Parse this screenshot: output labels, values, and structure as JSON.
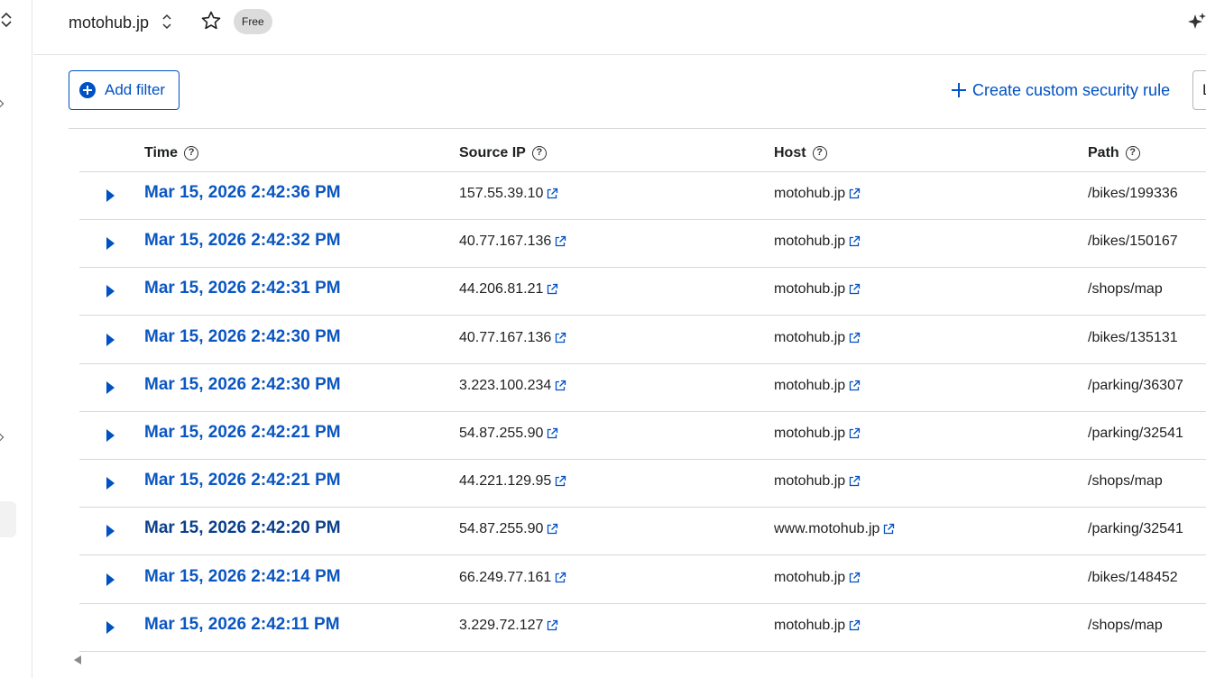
{
  "topbar": {
    "site": "motohub.jp",
    "plan_badge": "Free"
  },
  "toolbar": {
    "add_filter": "Add filter",
    "create_rule": "Create custom security rule",
    "cut_button_text": "L"
  },
  "table": {
    "columns": [
      "Time",
      "Source IP",
      "Host",
      "Path"
    ],
    "rows": [
      {
        "time": "Mar 15, 2026 2:42:36 PM",
        "ip": "157.55.39.10",
        "host": "motohub.jp",
        "path": "/bikes/199336"
      },
      {
        "time": "Mar 15, 2026 2:42:32 PM",
        "ip": "40.77.167.136",
        "host": "motohub.jp",
        "path": "/bikes/150167"
      },
      {
        "time": "Mar 15, 2026 2:42:31 PM",
        "ip": "44.206.81.21",
        "host": "motohub.jp",
        "path": "/shops/map"
      },
      {
        "time": "Mar 15, 2026 2:42:30 PM",
        "ip": "40.77.167.136",
        "host": "motohub.jp",
        "path": "/bikes/135131"
      },
      {
        "time": "Mar 15, 2026 2:42:30 PM",
        "ip": "3.223.100.234",
        "host": "motohub.jp",
        "path": "/parking/36307"
      },
      {
        "time": "Mar 15, 2026 2:42:21 PM",
        "ip": "54.87.255.90",
        "host": "motohub.jp",
        "path": "/parking/32541"
      },
      {
        "time": "Mar 15, 2026 2:42:21 PM",
        "ip": "44.221.129.95",
        "host": "motohub.jp",
        "path": "/shops/map"
      },
      {
        "time": "Mar 15, 2026 2:42:20 PM",
        "ip": "54.87.255.90",
        "host": "www.motohub.jp",
        "path": "/parking/32541"
      },
      {
        "time": "Mar 15, 2026 2:42:14 PM",
        "ip": "66.249.77.161",
        "host": "motohub.jp",
        "path": "/bikes/148452"
      },
      {
        "time": "Mar 15, 2026 2:42:11 PM",
        "ip": "3.229.72.127",
        "host": "motohub.jp",
        "path": "/shops/map"
      }
    ]
  },
  "icons": {
    "column_help": "question-circle-icon",
    "row_expand": "caret-right-icon",
    "external_link": "external-link-icon",
    "favorite": "star-icon",
    "assistant": "sparkle-icon"
  },
  "colors": {
    "accent": "#0051c3",
    "time_link": "#0b56c2",
    "border": "#d9d9d9",
    "badge_bg": "#dcdcdc"
  }
}
